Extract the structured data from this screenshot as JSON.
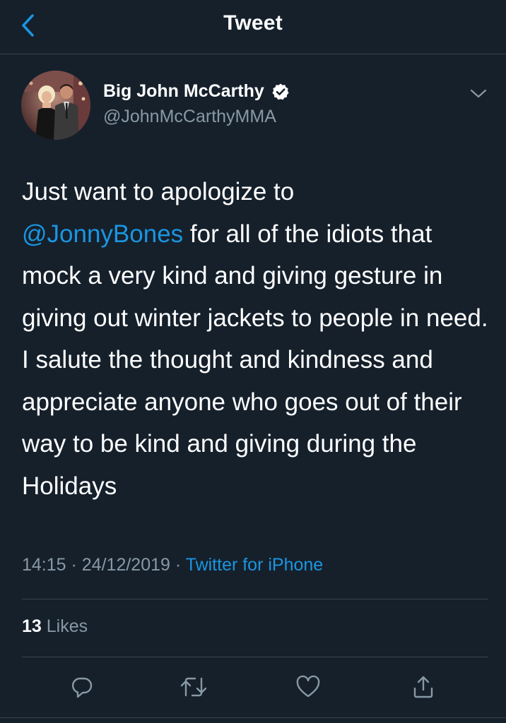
{
  "nav": {
    "title": "Tweet",
    "back_icon": "chevron-left-icon"
  },
  "author": {
    "display_name": "Big John McCarthy",
    "handle": "@JohnMcCarthyMMA",
    "verified": true,
    "verified_icon": "verified-badge-icon"
  },
  "tweet": {
    "text_before": "Just want to apologize to\n",
    "mention": "@JonnyBones",
    "text_after": " for all of the idiots that mock a very kind and giving gesture in giving out winter jackets to people in need. I salute the thought and kindness and appreciate anyone who goes out of their way to be kind and giving during the Holidays",
    "time": "14:15",
    "separator": " · ",
    "date": "24/12/2019",
    "source": "Twitter for iPhone"
  },
  "engagement": {
    "likes_count": "13",
    "likes_label": " Likes"
  },
  "actions": {
    "reply_icon": "reply-icon",
    "retweet_icon": "retweet-icon",
    "like_icon": "heart-icon",
    "share_icon": "share-icon"
  },
  "colors": {
    "background": "#15202b",
    "accent": "#1b95e0",
    "secondary_text": "#8899a6",
    "divider": "#38444d"
  }
}
